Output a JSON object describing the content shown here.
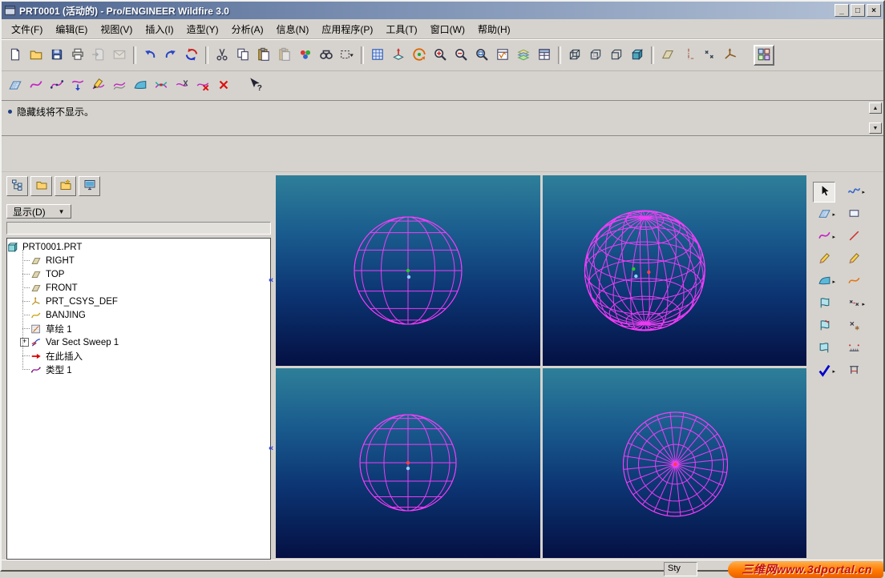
{
  "window": {
    "title": "PRT0001 (活动的) - Pro/ENGINEER Wildfire 3.0",
    "minimize_glyph": "_",
    "maximize_glyph": "□",
    "close_glyph": "×"
  },
  "menu": {
    "items": [
      {
        "id": "file",
        "label": "文件(F)"
      },
      {
        "id": "edit",
        "label": "编辑(E)"
      },
      {
        "id": "view",
        "label": "视图(V)"
      },
      {
        "id": "insert",
        "label": "插入(I)"
      },
      {
        "id": "styling",
        "label": "造型(Y)"
      },
      {
        "id": "analysis",
        "label": "分析(A)"
      },
      {
        "id": "info",
        "label": "信息(N)"
      },
      {
        "id": "applications",
        "label": "应用程序(P)"
      },
      {
        "id": "tools",
        "label": "工具(T)"
      },
      {
        "id": "window",
        "label": "窗口(W)"
      },
      {
        "id": "help",
        "label": "帮助(H)"
      }
    ]
  },
  "toolbar_main": {
    "items": [
      {
        "id": "new-file",
        "icon": "blank-page"
      },
      {
        "id": "open-file",
        "icon": "open-folder"
      },
      {
        "id": "save",
        "icon": "floppy-disk"
      },
      {
        "id": "print",
        "icon": "printer"
      },
      {
        "id": "copy-from",
        "icon": "page-import",
        "dim": true
      },
      {
        "id": "send-mail",
        "icon": "envelope",
        "dim": true
      },
      {
        "sep": true
      },
      {
        "id": "undo",
        "icon": "undo-arrow"
      },
      {
        "id": "redo",
        "icon": "redo-arrow"
      },
      {
        "id": "regenerate",
        "icon": "regenerate-arrows"
      },
      {
        "sep": true
      },
      {
        "id": "cut",
        "icon": "scissors"
      },
      {
        "id": "copy",
        "icon": "copy-pages"
      },
      {
        "id": "paste",
        "icon": "clipboard"
      },
      {
        "id": "paste-special",
        "icon": "clipboard",
        "dim": true
      },
      {
        "id": "appearance",
        "icon": "color-palette"
      },
      {
        "id": "find",
        "icon": "binoculars"
      },
      {
        "id": "selection-filter",
        "icon": "selection-box"
      },
      {
        "sep": true
      },
      {
        "id": "repaint",
        "icon": "repaint-grid"
      },
      {
        "id": "orient-mode",
        "icon": "orient-axes"
      },
      {
        "id": "spin-center",
        "icon": "spin-center"
      },
      {
        "id": "zoom-in",
        "icon": "zoom-in-magnifier"
      },
      {
        "id": "zoom-out",
        "icon": "zoom-out-magnifier"
      },
      {
        "id": "refit",
        "icon": "refit-magnifier"
      },
      {
        "id": "saved-views",
        "icon": "saved-views-list"
      },
      {
        "id": "layers",
        "icon": "layers-stack"
      },
      {
        "id": "view-manager",
        "icon": "view-manager-window"
      },
      {
        "sep": true
      },
      {
        "id": "wireframe-display",
        "icon": "wireframe-cube"
      },
      {
        "id": "hidden-line-display",
        "icon": "hidden-line-cube"
      },
      {
        "id": "no-hidden-display",
        "icon": "no-hidden-cube"
      },
      {
        "id": "shaded-display",
        "icon": "shaded-cube"
      },
      {
        "sep": true
      },
      {
        "id": "datum-planes-toggle",
        "icon": "datum-plane"
      },
      {
        "id": "datum-axes-toggle",
        "icon": "datum-axis"
      },
      {
        "id": "datum-points-toggle",
        "icon": "datum-points"
      },
      {
        "id": "csys-toggle",
        "icon": "coordinate-system"
      },
      {
        "id": "navigator-toggle",
        "icon": "navigator-grid",
        "raised": true
      }
    ]
  },
  "toolbar_style": {
    "items": [
      {
        "id": "set-active-plane",
        "icon": "active-plane-grid"
      },
      {
        "id": "style-curve",
        "icon": "style-wave"
      },
      {
        "id": "style-curve-points",
        "icon": "wave-points"
      },
      {
        "id": "style-drop-curve",
        "icon": "drop-curve"
      },
      {
        "id": "style-edit-curve",
        "icon": "pencil-wave"
      },
      {
        "id": "style-offset-curve",
        "icon": "offset-waves"
      },
      {
        "id": "style-surface",
        "icon": "surface-patch"
      },
      {
        "id": "style-connect",
        "icon": "connect-waves"
      },
      {
        "id": "style-trim",
        "icon": "trim-wave"
      },
      {
        "id": "style-delete-curve",
        "icon": "delete-wave-x"
      },
      {
        "id": "style-abort",
        "icon": "red-x"
      },
      {
        "id": "context-help",
        "icon": "context-help-arrow",
        "gap": true
      }
    ]
  },
  "message": {
    "text": "隐藏线将不显示。"
  },
  "navigator": {
    "tabs": [
      {
        "id": "model-tree-tab",
        "icon": "model-tree-diagram"
      },
      {
        "id": "folder-browser-tab",
        "icon": "open-folder"
      },
      {
        "id": "favorites-tab",
        "icon": "folder-star"
      },
      {
        "id": "connections-tab",
        "icon": "monitor-screen"
      }
    ],
    "show_label": "显示(D)",
    "tree": [
      {
        "id": "root",
        "label": "PRT0001.PRT",
        "icon": "part-cube",
        "indent": 0
      },
      {
        "id": "right-plane",
        "label": "RIGHT",
        "icon": "datum-plane",
        "indent": 1
      },
      {
        "id": "top-plane",
        "label": "TOP",
        "icon": "datum-plane",
        "indent": 1
      },
      {
        "id": "front-plane",
        "label": "FRONT",
        "icon": "datum-plane",
        "indent": 1
      },
      {
        "id": "csys",
        "label": "PRT_CSYS_DEF",
        "icon": "csys-tree",
        "indent": 1
      },
      {
        "id": "banjing",
        "label": "BANJING",
        "icon": "yellow-curve",
        "indent": 1
      },
      {
        "id": "sketch-1",
        "label": "草绘 1",
        "icon": "sketch-grid",
        "indent": 1
      },
      {
        "id": "var-sect-sweep-1",
        "label": "Var Sect Sweep 1",
        "icon": "sweep-section",
        "indent": 1,
        "plus": true
      },
      {
        "id": "insert-here",
        "label": "在此插入",
        "icon": "insert-here-arrow",
        "indent": 1
      },
      {
        "id": "style-1",
        "label": "类型 1",
        "icon": "magenta-wave-points",
        "indent": 1
      }
    ]
  },
  "graphics": {
    "wire_color": "#ff3cff",
    "bg_top": "#2e7f99",
    "bg_bottom": "#041043",
    "viewports": [
      {
        "name": "viewport-top-left",
        "view": "front",
        "r": 67,
        "fx": 0.5,
        "fy": 0.5,
        "lat": 8,
        "lon": 12,
        "markers": [
          [
            0,
            0,
            "#1ed41e"
          ],
          [
            1,
            8,
            "#8ad2ff"
          ]
        ]
      },
      {
        "name": "viewport-top-right",
        "view": "iso",
        "r": 75,
        "fx": 0.387,
        "fy": 0.5,
        "lat": 10,
        "lon": 20,
        "markers": [
          [
            -14,
            -2,
            "#1ed41e"
          ],
          [
            5,
            2,
            "#ff4040"
          ],
          [
            -11,
            7,
            "#8ad2ff"
          ]
        ]
      },
      {
        "name": "viewport-bottom-left",
        "view": "front",
        "r": 60,
        "fx": 0.5,
        "fy": 0.498,
        "lat": 8,
        "lon": 12,
        "markers": [
          [
            0,
            0,
            "#ff4040"
          ],
          [
            0,
            7,
            "#8ad2ff"
          ]
        ]
      },
      {
        "name": "viewport-bottom-right",
        "view": "polar",
        "r": 65,
        "fx": 0.503,
        "fy": 0.506,
        "lat": 8,
        "lon": 24,
        "markers": [
          [
            0,
            0,
            "#ff4040"
          ]
        ]
      }
    ]
  },
  "right_toolbar_primary": {
    "items": [
      {
        "id": "select-items",
        "icon": "select-cursor",
        "pressed": true
      },
      {
        "id": "active-plane-flyout",
        "icon": "active-plane-grid",
        "fly": true
      },
      {
        "id": "curve-flyout",
        "icon": "style-wave",
        "fly": true
      },
      {
        "id": "edit-curve",
        "icon": "pencil"
      },
      {
        "id": "surface-flyout",
        "icon": "surface-patch",
        "fly": true
      },
      {
        "id": "surface-edit",
        "icon": "surface-fan"
      },
      {
        "id": "surface-connect",
        "icon": "surface-fan-arrow"
      },
      {
        "id": "surface-trim",
        "icon": "surface-fan-flip"
      },
      {
        "id": "done",
        "icon": "blue-check",
        "fly": true
      }
    ]
  },
  "right_toolbar_secondary": {
    "items": [
      {
        "id": "curve-tool",
        "icon": "blue-wave",
        "fly": true
      },
      {
        "id": "rectangle-tool",
        "icon": "rectangle"
      },
      {
        "id": "line-tool",
        "icon": "red-line"
      },
      {
        "id": "sketch-tool",
        "icon": "pencil"
      },
      {
        "id": "arc-tool",
        "icon": "orange-wave"
      },
      {
        "id": "point-tool",
        "icon": "x-points",
        "fly": true
      },
      {
        "id": "delete-tool",
        "icon": "x-star"
      },
      {
        "id": "dimension-tool",
        "icon": "dimension-ruler"
      },
      {
        "id": "measure-tool",
        "icon": "measure-caliper"
      }
    ]
  },
  "statusbar": {
    "mode": "Sty"
  },
  "watermark": {
    "text": "三维网www.3dportal.cn"
  }
}
